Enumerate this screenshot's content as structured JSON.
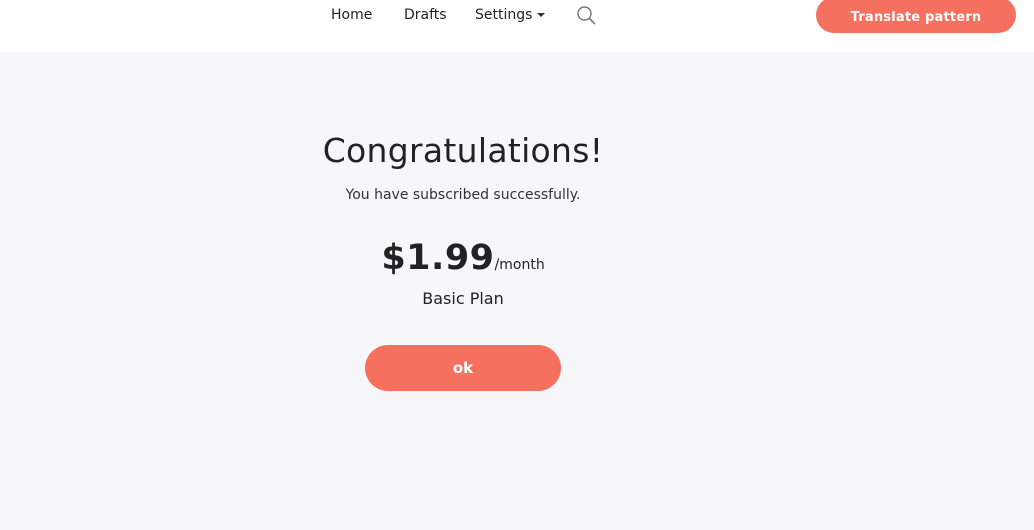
{
  "nav": {
    "home": "Home",
    "drafts": "Drafts",
    "settings": "Settings",
    "search_icon": "search-icon",
    "translate_button": "Translate pattern"
  },
  "confirmation": {
    "title": "Congratulations!",
    "message": "You have subscribed successfully.",
    "price": "$1.99",
    "period": "/month",
    "plan": "Basic Plan",
    "ok_button": "ok"
  },
  "colors": {
    "accent": "#f5705f",
    "background": "#f7f7f9",
    "header": "#ffffff",
    "text": "#222222"
  }
}
